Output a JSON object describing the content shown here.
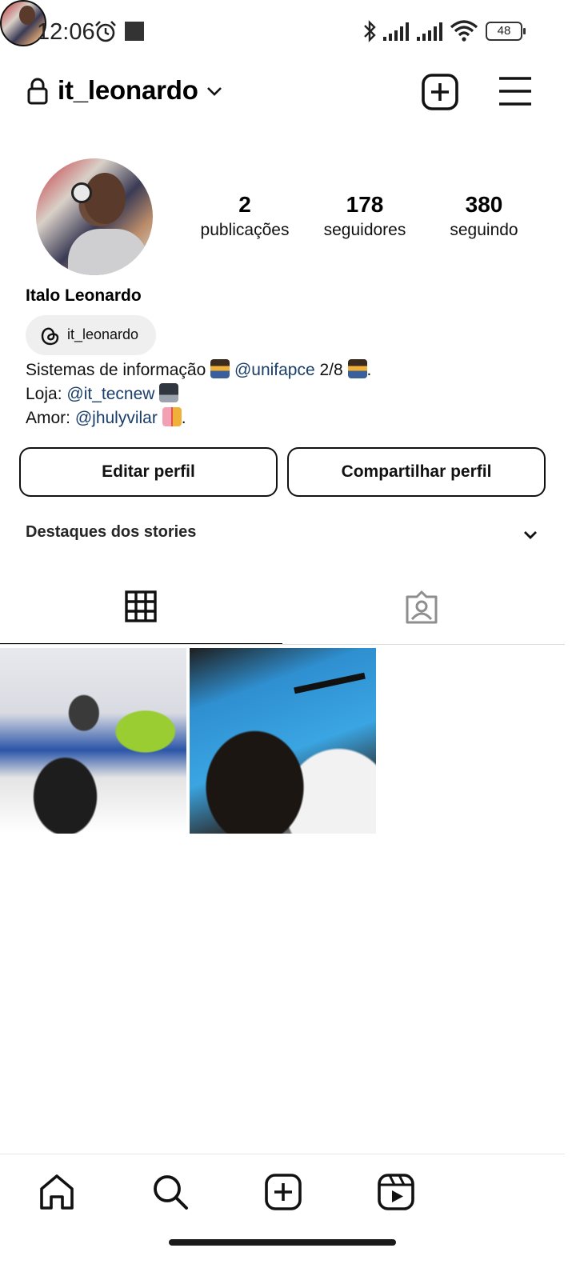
{
  "status_bar": {
    "time": "12:06",
    "battery": "48",
    "icons": [
      "alarm-icon",
      "notification-square-icon",
      "bluetooth-icon",
      "signal-icon",
      "signal-icon",
      "wifi-icon",
      "battery-icon"
    ]
  },
  "header": {
    "username": "it_leonardo",
    "icons": [
      "lock-icon",
      "chevron-down-icon",
      "new-post-icon",
      "menu-icon"
    ]
  },
  "profile": {
    "stats": [
      {
        "value": "2",
        "label": "publicações"
      },
      {
        "value": "178",
        "label": "seguidores"
      },
      {
        "value": "380",
        "label": "seguindo"
      }
    ],
    "full_name": "Italo Leonardo",
    "threads_handle": "it_leonardo",
    "bio": {
      "line1_prefix": "Sistemas de informação ",
      "line1_mention": "@unifapce",
      "line1_suffix": " 2/8 ",
      "line2_prefix": "Loja: ",
      "line2_mention": "@it_tecnew",
      "line3_prefix": "Amor: ",
      "line3_mention": "@jhulyvilar",
      "line3_suffix": "."
    }
  },
  "actions": {
    "edit_label": "Editar perfil",
    "share_label": "Compartilhar perfil"
  },
  "highlights": {
    "label": "Destaques dos stories"
  },
  "tabs": [
    "grid-icon",
    "tagged-icon"
  ],
  "bottom_nav": [
    "home-icon",
    "search-icon",
    "create-icon",
    "reels-icon",
    "profile-avatar"
  ],
  "colors": {
    "mention": "#1a3d6b",
    "pill_bg": "#efefef",
    "text": "#000000"
  }
}
